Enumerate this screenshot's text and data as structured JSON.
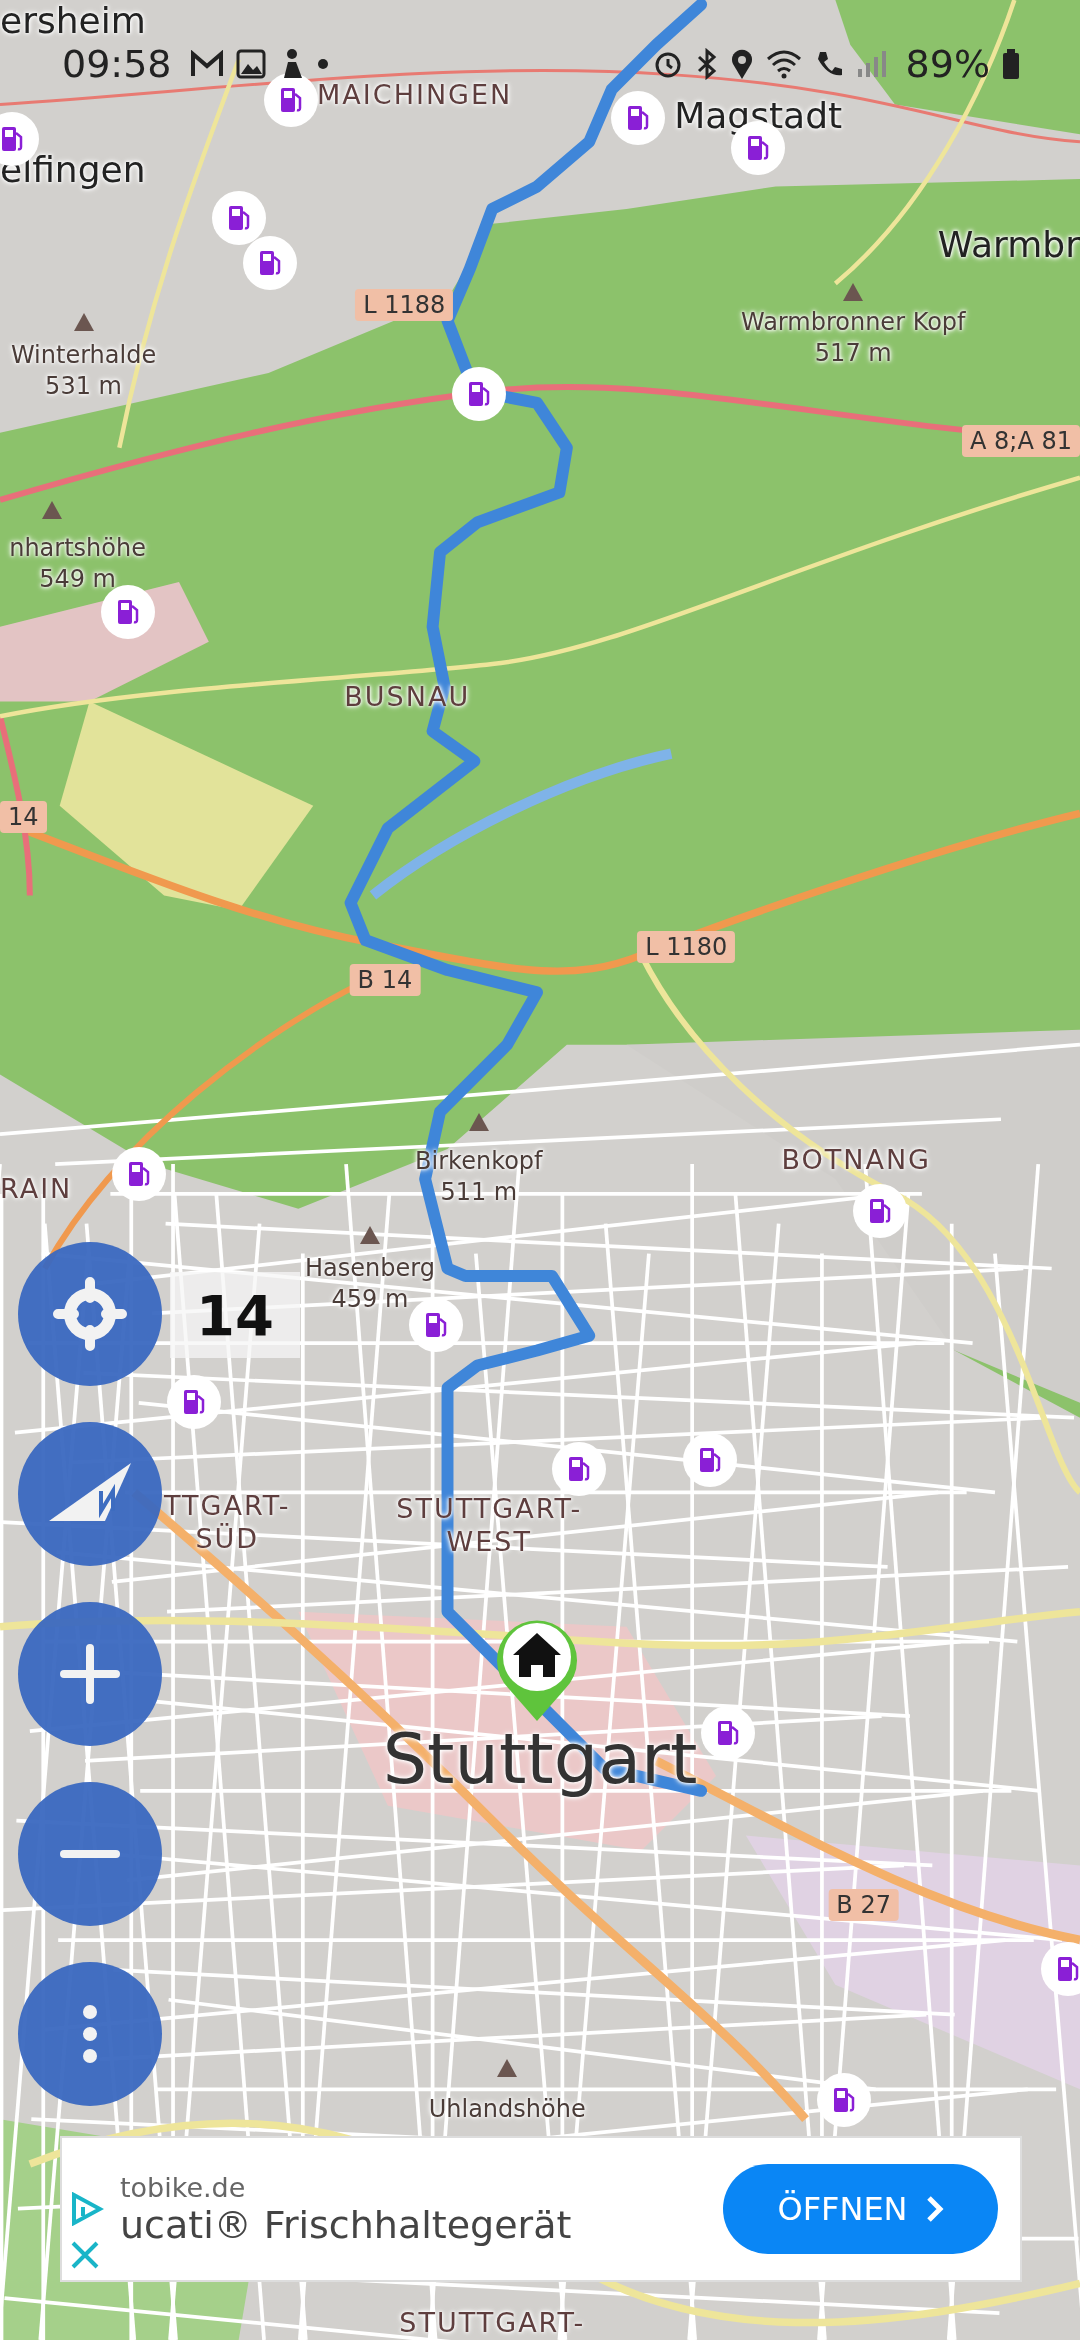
{
  "status_bar": {
    "time": "09:58",
    "battery": "89%"
  },
  "map": {
    "labels": [
      {
        "kind": "place",
        "text": "ersheim"
      },
      {
        "kind": "district",
        "text": "MAICHINGEN"
      },
      {
        "kind": "town",
        "text": "Magstadt"
      },
      {
        "kind": "town",
        "text": "elfingen"
      },
      {
        "kind": "town",
        "text": "Warmbr"
      },
      {
        "kind": "road",
        "text": "L 1188"
      },
      {
        "kind": "peak",
        "text": "Winterhalde",
        "subtext": "531 m"
      },
      {
        "kind": "peak",
        "text": "Warmbronner Kopf",
        "subtext": "517 m"
      },
      {
        "kind": "road",
        "text": "A 8;A 81"
      },
      {
        "kind": "peak",
        "text": "nhartshöhe",
        "subtext": "549 m"
      },
      {
        "kind": "district",
        "text": "BUSNAU"
      },
      {
        "kind": "road",
        "text": "14"
      },
      {
        "kind": "road",
        "text": "L 1180"
      },
      {
        "kind": "road",
        "text": "B 14"
      },
      {
        "kind": "peak",
        "text": "Birkenkopf",
        "subtext": "511 m"
      },
      {
        "kind": "district",
        "text": "BOTNANG"
      },
      {
        "kind": "district",
        "text": "RAIN"
      },
      {
        "kind": "peak",
        "text": "Hasenberg",
        "subtext": "459 m"
      },
      {
        "kind": "district",
        "text": "TTGART-",
        "subtext": "SÜD"
      },
      {
        "kind": "district",
        "text": "STUTTGART-",
        "subtext": "WEST"
      },
      {
        "kind": "city",
        "text": "Stuttgart"
      },
      {
        "kind": "road",
        "text": "B 27"
      },
      {
        "kind": "peak",
        "text": "Uhlandshöhe"
      },
      {
        "kind": "district",
        "text": "STUTTGART-"
      }
    ],
    "zoom_level": "14"
  },
  "ad": {
    "domain": "tobike.de",
    "headline": "ucati® Frischhaltegerät",
    "button": "ÖFFNEN"
  }
}
